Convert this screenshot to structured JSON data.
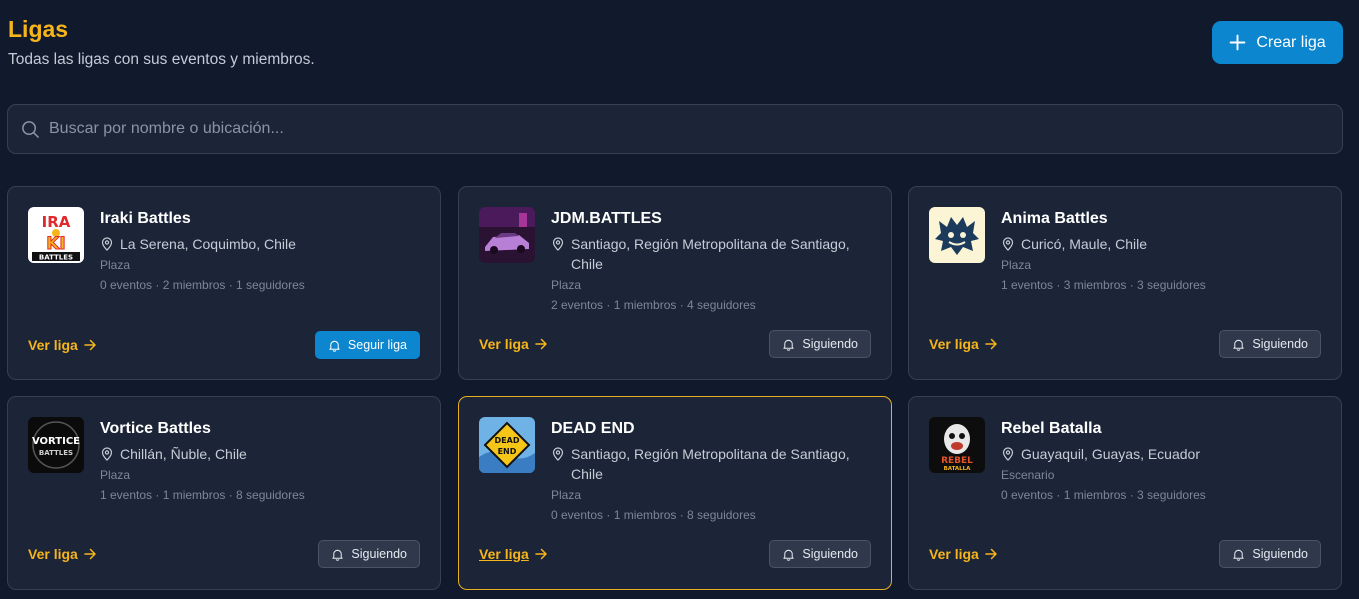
{
  "header": {
    "title": "Ligas",
    "subtitle": "Todas las ligas con sus eventos y miembros.",
    "create_label": "Crear liga"
  },
  "search": {
    "placeholder": "Buscar por nombre o ubicación..."
  },
  "leagues": [
    {
      "name": "Iraki Battles",
      "location": "La Serena, Coquimbo, Chile",
      "place": "Plaza",
      "stats": "0 eventos · 2 miembros · 1 seguidores",
      "view_label": "Ver liga",
      "action_label": "Seguir liga",
      "action_state": "follow",
      "logo_icon": "iraki-battles-logo",
      "logo_text": [
        "IRA",
        "KI",
        "BATTLES"
      ]
    },
    {
      "name": "JDM.BATTLES",
      "location": "Santiago, Región Metropolitana de Santiago, Chile",
      "place": "Plaza",
      "stats": "2 eventos · 1 miembros · 4 seguidores",
      "view_label": "Ver liga",
      "action_label": "Siguiendo",
      "action_state": "following",
      "logo_icon": "jdm-battles-logo"
    },
    {
      "name": "Anima Battles",
      "location": "Curicó, Maule, Chile",
      "place": "Plaza",
      "stats": "1 eventos · 3 miembros · 3 seguidores",
      "view_label": "Ver liga",
      "action_label": "Siguiendo",
      "action_state": "following",
      "logo_icon": "anima-battles-logo"
    },
    {
      "name": "Vortice Battles",
      "location": "Chillán, Ñuble, Chile",
      "place": "Plaza",
      "stats": "1 eventos · 1 miembros · 8 seguidores",
      "view_label": "Ver liga",
      "action_label": "Siguiendo",
      "action_state": "following",
      "logo_icon": "vortice-battles-logo",
      "logo_text": [
        "VORTICE",
        "BATTLES"
      ]
    },
    {
      "name": "DEAD END",
      "location": "Santiago, Región Metropolitana de Santiago, Chile",
      "place": "Plaza",
      "stats": "0 eventos · 1 miembros · 8 seguidores",
      "view_label": "Ver liga",
      "action_label": "Siguiendo",
      "action_state": "following",
      "logo_icon": "dead-end-logo",
      "logo_text": [
        "DEAD",
        "END"
      ]
    },
    {
      "name": "Rebel Batalla",
      "location": "Guayaquil, Guayas, Ecuador",
      "place": "Escenario",
      "stats": "0 eventos · 1 miembros · 3 seguidores",
      "view_label": "Ver liga",
      "action_label": "Siguiendo",
      "action_state": "following",
      "logo_icon": "rebel-batalla-logo",
      "logo_text": [
        "REBEL",
        "BATALLA"
      ]
    }
  ],
  "colors": {
    "accent": "#f7b51c",
    "primary": "#0b86cf",
    "background": "#111a2c",
    "card": "#1b2537",
    "highlight_border": "#e9ad22"
  }
}
